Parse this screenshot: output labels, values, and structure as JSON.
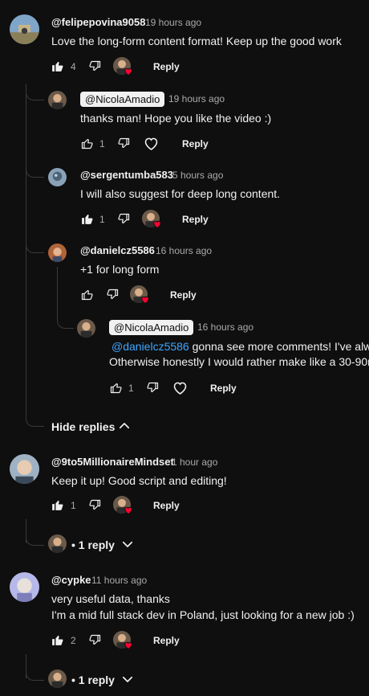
{
  "comments": [
    {
      "author": "@felipepovina9058",
      "time": "19 hours ago",
      "text": "Love the long-form content format! Keep up the good work",
      "likes": "4",
      "reply": "Reply"
    },
    {
      "author": "@NicolaAmadio",
      "time": "19 hours ago",
      "text": "thanks man! Hope you like the video :)",
      "likes": "1",
      "reply": "Reply"
    },
    {
      "author": "@sergentumba583",
      "time": "5 hours ago",
      "text": "I will also suggest for deep long content.",
      "likes": "1",
      "reply": "Reply"
    },
    {
      "author": "@danielcz5586",
      "time": "16 hours ago",
      "text": "+1 for long form",
      "reply": "Reply"
    },
    {
      "author": "@NicolaAmadio",
      "time": "16 hours ago",
      "mention": "@danielcz5586",
      "text_line1": " gonna see more comments! I've alw",
      "text_line2": "Otherwise honestly I would rather make like a 30-90m",
      "likes": "1",
      "reply": "Reply"
    },
    {
      "author": "@9to5MillionaireMindset",
      "time": "1 hour ago",
      "text": "Keep it up! Good script and editing!",
      "likes": "1",
      "reply": "Reply",
      "replies_label": "1 reply"
    },
    {
      "author": "@cypke",
      "time": "11 hours ago",
      "text_line1": "very useful data, thanks",
      "text_line2": "I'm a mid full stack dev in Poland, just looking for a new job :)",
      "likes": "2",
      "reply": "Reply",
      "replies_label": "1 reply"
    }
  ],
  "hide_replies": "Hide replies",
  "icons": {
    "like": "thumbs-up-icon",
    "dislike": "thumbs-down-icon",
    "heart": "heart-icon",
    "chevron_up": "chevron-up-icon",
    "chevron_down": "chevron-down-icon"
  },
  "colors": {
    "background": "#0f0f0f",
    "text": "#f1f1f1",
    "secondary": "#aaaaaa",
    "mention": "#3ea6ff",
    "heart": "#ff0033"
  }
}
